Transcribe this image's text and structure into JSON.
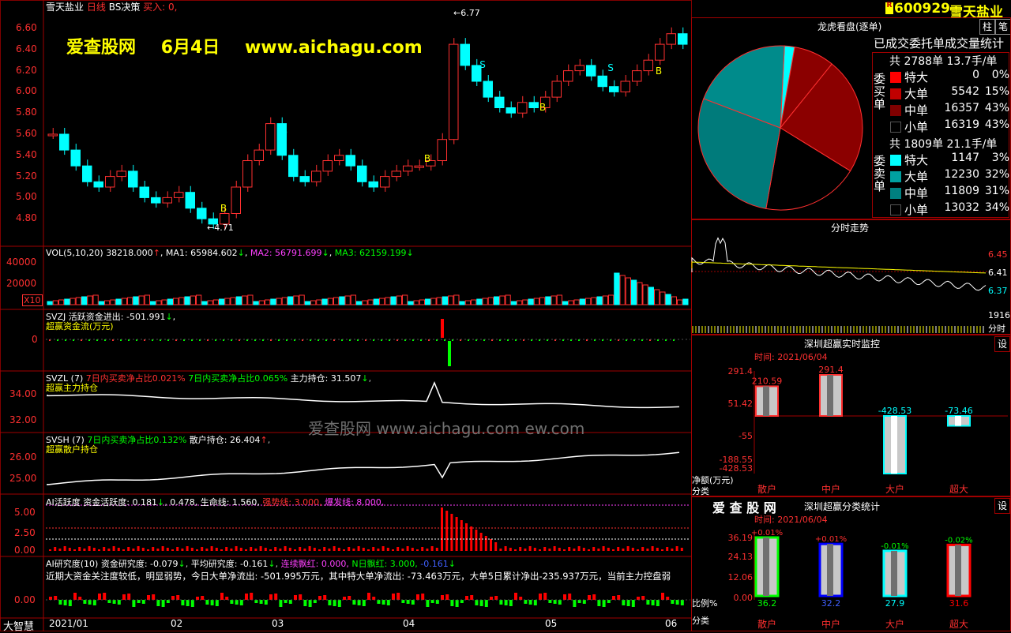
{
  "header": {
    "stock_name": "雪天盐业",
    "period": "日线",
    "strategy": "BS决策",
    "buy_label": "买入",
    "buy_value": "0,",
    "code_badge": "R",
    "code": "600929",
    "code_name": "雪天盐业",
    "btn_pin": "柱",
    "btn_note": "笔"
  },
  "watermark": {
    "site_name": "爱查股网",
    "date": "6月4日",
    "url": "www.aichagu.com",
    "center": "爱查股网   www.aichagu.com   ew.com"
  },
  "price_axis": [
    "6.60",
    "6.40",
    "6.20",
    "6.00",
    "5.80",
    "5.60",
    "5.40",
    "5.20",
    "5.00",
    "4.80"
  ],
  "price_markers": {
    "high": "6.77",
    "low": "4.71"
  },
  "signals": {
    "b": "B",
    "s": "S"
  },
  "vol": {
    "header_name": "VOL(5,10,20)",
    "header_value": "38218.000",
    "ma1": "MA1: 65984.602",
    "ma2": "MA2: 56791.699",
    "ma3": "MA3: 62159.199",
    "axis": [
      "40000",
      "20000"
    ],
    "unit": "X10"
  },
  "svzj": {
    "line1": "SVZJ  活跃资金进出: -501.991",
    "line2": "超赢资金流(万元)",
    "axis": [
      "0"
    ]
  },
  "svzl": {
    "name": "SVZL (7)",
    "t1": "7日内买卖净占比0.021%",
    "t2": "7日内买卖净占比0.065%",
    "t3": "主力持仓: 31.507",
    "line2": "超赢主力持仓",
    "axis": [
      "34.00",
      "32.00"
    ]
  },
  "svsh": {
    "name": "SVSH (7)",
    "t1": "7日内买卖净占比0.132%",
    "t2": "散户持仓: 26.404",
    "line2": "超赢散户持仓",
    "axis": [
      "26.00",
      "25.00"
    ]
  },
  "ai_active": {
    "name": "AI活跃度",
    "t1": "资金活跃度: 0.181",
    "t2": "0.478,",
    "t3": "生命线: 1.560,",
    "t4": "强势线: 3.000,",
    "t5": "爆发线: 8.000,",
    "axis": [
      "5.00",
      "2.50",
      "0.00"
    ]
  },
  "ai_research": {
    "name": "AI研究度(10)",
    "t1": "资金研究度: -0.079",
    "t2": "平均研究度: -0.161",
    "t3": "连续飘红: 0.000,",
    "t4": "N日飘红: 3.000,",
    "t5": "-0.161",
    "line2": "近期大资金关注度较低，明显弱势，今日大单净流出: -501.995万元，其中特大单净流出: -73.463万元，大单5日累计净出-235.937万元，当前主力控盘弱",
    "axis": [
      "0.00"
    ]
  },
  "footer": {
    "logo": "大智慧",
    "dates": [
      "2021/01",
      "02",
      "03",
      "04",
      "05",
      "06"
    ]
  },
  "dragon": {
    "title": "龙虎看盘(逐单)",
    "stat_title": "已成交委托单成交量统计",
    "buy_side": "委买单",
    "sell_side": "委卖单",
    "buy_total": "共 2788单 13.7手/单",
    "sell_total": "共 1809单 21.1手/单",
    "buy_rows": [
      {
        "label": "特大",
        "count": "0",
        "pct": "0%",
        "color": "#ff0000"
      },
      {
        "label": "大单",
        "count": "5542",
        "pct": "15%",
        "color": "#c00000"
      },
      {
        "label": "中单",
        "count": "16357",
        "pct": "43%",
        "color": "#800000"
      },
      {
        "label": "小单",
        "count": "16319",
        "pct": "43%",
        "color": "#000000"
      }
    ],
    "sell_rows": [
      {
        "label": "特大",
        "count": "1147",
        "pct": "3%",
        "color": "#00ffff"
      },
      {
        "label": "大单",
        "count": "12230",
        "pct": "32%",
        "color": "#00a0a0"
      },
      {
        "label": "中单",
        "count": "11809",
        "pct": "31%",
        "color": "#008080"
      },
      {
        "label": "小单",
        "count": "13032",
        "pct": "34%",
        "color": "#000000"
      }
    ]
  },
  "intraday": {
    "title": "分时走势",
    "prices": [
      "6.45",
      "6.41",
      "6.37"
    ],
    "vol_label": "1916",
    "time_label": "分时"
  },
  "realtime": {
    "title": "深圳超赢实时监控",
    "settings": "设",
    "time": "时间: 2021/06/04",
    "axis": [
      "291.4",
      "51.42",
      "-55",
      "-188.55",
      "-428.53"
    ],
    "unit": "净额(万元)",
    "cat_label": "分类",
    "chart_data": {
      "type": "bar",
      "categories": [
        "散户",
        "中户",
        "大户",
        "超大"
      ],
      "values": [
        210.59,
        291.4,
        -428.53,
        -73.46
      ]
    }
  },
  "classify": {
    "brand": "爱 查 股 网",
    "title": "深圳超赢分类统计",
    "settings": "设",
    "time": "时间: 2021/06/04",
    "axis": [
      "36.19",
      "24.13",
      "12.06",
      "0.00"
    ],
    "unit": "比例%",
    "cat_label": "分类",
    "chart_data": {
      "type": "bar",
      "categories": [
        "散户",
        "中户",
        "大户",
        "超大"
      ],
      "values": [
        36.2,
        32.2,
        27.9,
        31.6
      ],
      "deltas": [
        "+0.01%",
        "+0.01%",
        "-0.01%",
        "-0.02%"
      ],
      "colors": [
        "#00ff00",
        "#0000ff",
        "#00ffff",
        "#ff0000"
      ]
    }
  }
}
